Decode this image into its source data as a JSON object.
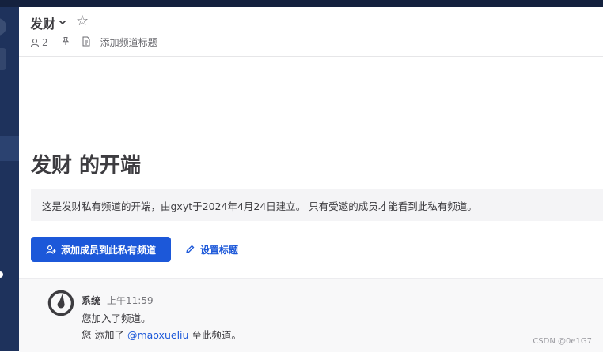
{
  "header": {
    "channel_name": "发财",
    "member_count": "2",
    "add_header_label": "添加频道标题"
  },
  "intro": {
    "title": "发财 的开端",
    "description": "这是发财私有频道的开端，由gxyt于2024年4月24日建立。 只有受邀的成员才能看到此私有频道。",
    "add_members_label": "添加成员到此私有频道",
    "set_header_label": "设置标题"
  },
  "message": {
    "author": "系统",
    "time": "上午11:59",
    "line1": "您加入了频道。",
    "line2_prefix": "您 添加了 ",
    "mention": "@maoxueliu",
    "line2_suffix": " 至此频道。"
  },
  "watermark": "CSDN @0e1G7",
  "colors": {
    "accent": "#1c58d9",
    "sidebar": "#1e325c",
    "topbar": "#14213e"
  }
}
